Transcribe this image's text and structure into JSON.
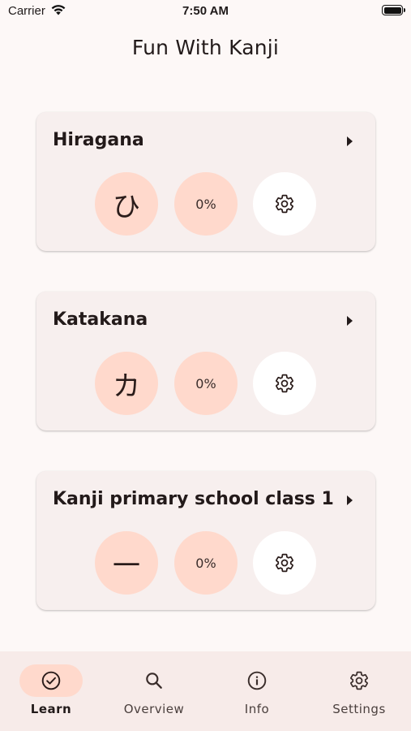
{
  "status_bar": {
    "carrier": "Carrier",
    "time": "7:50 AM"
  },
  "app": {
    "title": "Fun With Kanji"
  },
  "cards": [
    {
      "title": "Hiragana",
      "character": "ひ",
      "progress": "0%"
    },
    {
      "title": "Katakana",
      "character": "カ",
      "progress": "0%"
    },
    {
      "title": "Kanji primary school class 1",
      "character": "一",
      "progress": "0%"
    }
  ],
  "nav": [
    {
      "label": "Learn",
      "icon": "check-circle-icon",
      "active": true
    },
    {
      "label": "Overview",
      "icon": "search-icon",
      "active": false
    },
    {
      "label": "Info",
      "icon": "info-icon",
      "active": false
    },
    {
      "label": "Settings",
      "icon": "gear-icon",
      "active": false
    }
  ],
  "colors": {
    "accent": "#ffd9cc",
    "card": "#f7efee",
    "background": "#fdf8f7",
    "nav": "#f7ebe9"
  }
}
